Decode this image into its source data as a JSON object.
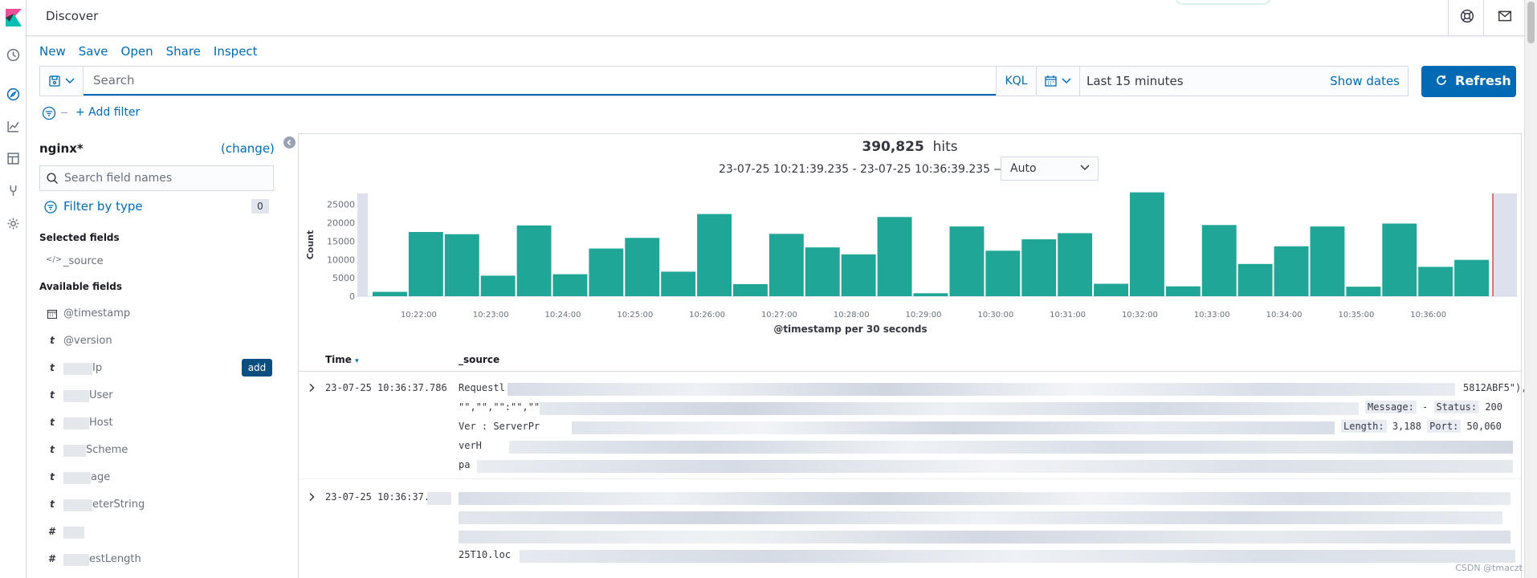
{
  "app": {
    "title": "Discover"
  },
  "menu": [
    {
      "label": "New"
    },
    {
      "label": "Save"
    },
    {
      "label": "Open"
    },
    {
      "label": "Share"
    },
    {
      "label": "Inspect"
    }
  ],
  "search": {
    "placeholder": "Search",
    "language": "KQL"
  },
  "time": {
    "range": "Last 15 minutes",
    "show_dates": "Show dates",
    "refresh": "Refresh"
  },
  "filters": {
    "add_label": "+ Add filter"
  },
  "sidebar": {
    "index_pattern": "nginx*",
    "change_label": "(change)",
    "field_search_placeholder": "Search field names",
    "filter_by_type": "Filter by type",
    "filter_count": "0",
    "selected_heading": "Selected fields",
    "selected": [
      {
        "type": "</>",
        "name": "_source"
      }
    ],
    "available_heading": "Available fields",
    "add_label": "add",
    "available": [
      {
        "type": "cal",
        "name": "@timestamp"
      },
      {
        "type": "t",
        "name": "@version"
      },
      {
        "type": "t",
        "name": "Ip"
      },
      {
        "type": "t",
        "name": "User"
      },
      {
        "type": "t",
        "name": "Host"
      },
      {
        "type": "t",
        "name": "Scheme"
      },
      {
        "type": "t",
        "name": "age"
      },
      {
        "type": "t",
        "name": "eterString"
      },
      {
        "type": "#",
        "name": ""
      },
      {
        "type": "#",
        "name": "estLength"
      }
    ]
  },
  "results": {
    "hits_count": "390,825",
    "hits_label": "hits",
    "range_text": "23-07-25 10:21:39.235 - 23-07-25 10:36:39.235 —",
    "interval": "Auto",
    "columns": {
      "time": "Time",
      "source": "_source"
    },
    "rows": [
      {
        "time": "23-07-25 10:36:37.786",
        "lines": [
          "Requestl",
          "\"\",\"\",\"\":\"\",\"\",",
          "Ver   : ServerPr",
          "   verH",
          "pa"
        ],
        "tokens": [
          {
            "k": "Message:",
            "v": "-"
          },
          {
            "k": "Status:",
            "v": "200"
          },
          {
            "k": "Length:",
            "v": "3,188"
          },
          {
            "k": "Port:",
            "v": "50,060"
          }
        ],
        "tail": "5812ABF5\"),"
      },
      {
        "time": "23-07-25 10:36:37.",
        "lines": [
          "",
          "",
          "",
          "25T10.loc"
        ],
        "tokens": [],
        "tail": ""
      }
    ]
  },
  "watermark": "CSDN @tmaczt",
  "chart_data": {
    "type": "bar",
    "ylabel": "Count",
    "xlabel": "@timestamp per 30 seconds",
    "ylim": [
      0,
      28000
    ],
    "yticks": [
      0,
      5000,
      10000,
      15000,
      20000,
      25000
    ],
    "xticks": [
      "10:22:00",
      "10:23:00",
      "10:24:00",
      "10:25:00",
      "10:26:00",
      "10:27:00",
      "10:28:00",
      "10:29:00",
      "10:30:00",
      "10:31:00",
      "10:32:00",
      "10:33:00",
      "10:34:00",
      "10:35:00",
      "10:36:00"
    ],
    "values": [
      1200,
      17500,
      16900,
      5600,
      19300,
      6000,
      13000,
      15900,
      6700,
      22400,
      3300,
      17000,
      13300,
      11400,
      21600,
      800,
      19000,
      12400,
      15500,
      17200,
      3400,
      28300,
      2700,
      19400,
      8800,
      13600,
      19000,
      2600,
      19800,
      8000,
      9900
    ],
    "color": "#20a696",
    "partial_bucket_color": "#d3dae6"
  }
}
